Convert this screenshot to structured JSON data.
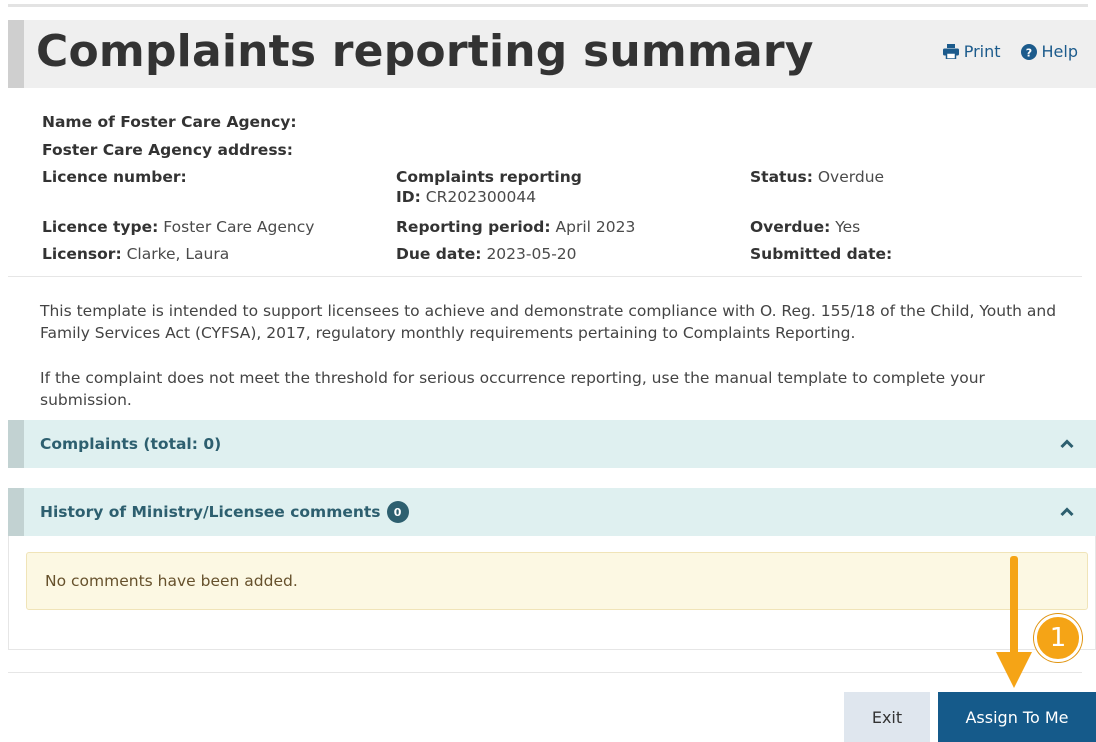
{
  "page": {
    "title": "Complaints reporting summary",
    "print_label": "Print",
    "help_label": "Help"
  },
  "info": {
    "agency_name_label": "Name of Foster Care Agency:",
    "agency_address_label": "Foster Care Agency address:",
    "licence_number_label": "Licence number:",
    "complaints_id_label_line1": "Complaints reporting",
    "complaints_id_label_line2": "ID:",
    "complaints_id_value": "CR202300044",
    "status_label": "Status:",
    "status_value": "Overdue",
    "licence_type_label": "Licence type:",
    "licence_type_value": "Foster Care Agency",
    "reporting_period_label": "Reporting period:",
    "reporting_period_value": "April 2023",
    "overdue_label": "Overdue:",
    "overdue_value": "Yes",
    "licensor_label": "Licensor:",
    "licensor_value": "Clarke, Laura",
    "due_date_label": "Due date:",
    "due_date_value": "2023-05-20",
    "submitted_date_label": "Submitted date:"
  },
  "description": {
    "paragraph1": "This template is intended to support licensees to achieve and demonstrate compliance with O. Reg. 155/18 of the Child, Youth and Family Services Act (CYFSA), 2017, regulatory monthly requirements pertaining to Complaints Reporting.",
    "paragraph2": "If the complaint does not meet the threshold for serious occurrence reporting, use the manual template to complete your submission."
  },
  "panels": {
    "complaints_title": "Complaints (total: 0)",
    "history_title": "History of Ministry/Licensee comments",
    "history_count": "0",
    "no_comments_text": "No comments have been added."
  },
  "buttons": {
    "exit_label": "Exit",
    "assign_label": "Assign To Me"
  },
  "annotation": {
    "callout_number": "1"
  },
  "colors": {
    "accent": "#155a8a",
    "panel_header_bg": "#dff0f0",
    "notice_bg": "#fcf8e3",
    "callout": "#f5a416"
  },
  "icons": [
    "printer-icon",
    "question-circle-icon",
    "chevron-up-icon",
    "arrow-down-icon"
  ]
}
